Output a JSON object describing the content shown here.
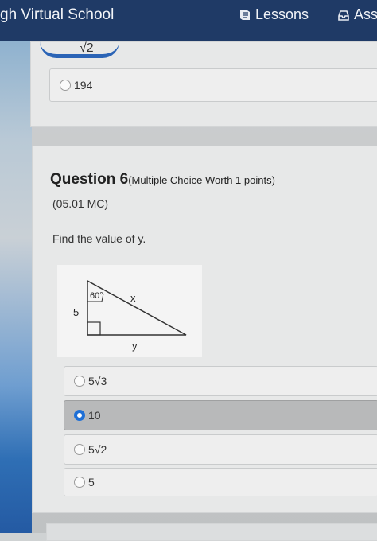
{
  "header": {
    "brand": "gh Virtual School",
    "lessons_label": "Lessons",
    "assess_label": "Ass"
  },
  "prev_question": {
    "partial_answer": "√2",
    "option_text": "194"
  },
  "question": {
    "title_main": "Question 6",
    "title_worth": "(Multiple Choice Worth 1 points)",
    "code": "(05.01 MC)",
    "prompt": "Find the value of y.",
    "figure": {
      "angle_label": "60°",
      "side_left": "5",
      "side_hyp": "x",
      "side_bottom": "y"
    },
    "options": [
      {
        "label": "5√3",
        "selected": false
      },
      {
        "label": "10",
        "selected": true
      },
      {
        "label": "5√2",
        "selected": false
      },
      {
        "label": "5",
        "selected": false
      }
    ]
  },
  "colors": {
    "topbar": "#1f3a66",
    "selected_radio": "#1e6fd6"
  }
}
